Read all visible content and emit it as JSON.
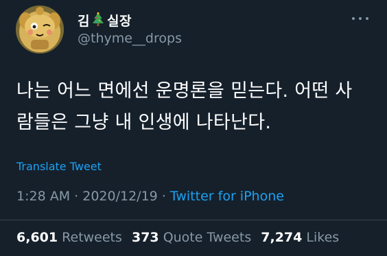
{
  "user": {
    "display_name_before": "김",
    "display_name_emoji": "christmas-tree-emoji",
    "display_name_after": "실장",
    "handle": "@thyme__drops",
    "avatar_icon": "character-avatar"
  },
  "tweet": {
    "text_line1": "나는 어느 면에선 운명론을 믿는다. 어떤 사",
    "text_line2": "람들은 그냥 내 인생에 나타난다.",
    "translate_label": "Translate Tweet",
    "time": "1:28 AM",
    "date": "2020/12/19",
    "separator": "·",
    "source": "Twitter for iPhone"
  },
  "stats": {
    "retweets_count": "6,601",
    "retweets_label": "Retweets",
    "quotes_count": "373",
    "quotes_label": "Quote Tweets",
    "likes_count": "7,274",
    "likes_label": "Likes"
  },
  "colors": {
    "background": "#15202b",
    "text_primary": "#ffffff",
    "text_secondary": "#8899a6",
    "link": "#1da1f2",
    "divider": "#38444d"
  }
}
